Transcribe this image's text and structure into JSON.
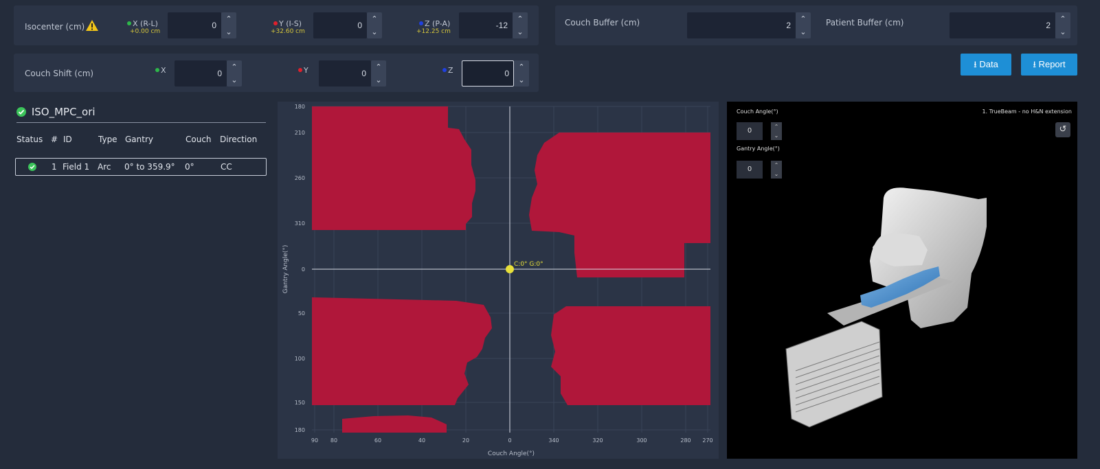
{
  "isocenter": {
    "label": "Isocenter (cm)",
    "warning_icon": "warning-triangle-icon",
    "x": {
      "label": "X (R-L)",
      "sub": "+0.00 cm",
      "value": "0",
      "color": "#2eb84a"
    },
    "y": {
      "label": "Y (I-S)",
      "sub": "+32.60 cm",
      "value": "0",
      "color": "#e0202c"
    },
    "z": {
      "label": "Z (P-A)",
      "sub": "+12.25 cm",
      "value": "-12",
      "color": "#2040e0"
    }
  },
  "couch_buffer": {
    "label": "Couch Buffer (cm)",
    "value": "2"
  },
  "patient_buffer": {
    "label": "Patient Buffer (cm)",
    "value": "2"
  },
  "couch_shift": {
    "label": "Couch Shift (cm)",
    "x": {
      "label": "X",
      "value": "0"
    },
    "y": {
      "label": "Y",
      "value": "0"
    },
    "z": {
      "label": "Z",
      "value": "0"
    }
  },
  "buttons": {
    "data": "Data",
    "report": "Report"
  },
  "plan": {
    "name": "ISO_MPC_ori",
    "columns": [
      "Status",
      "#",
      "ID",
      "Type",
      "Gantry",
      "Couch",
      "Direction"
    ],
    "rows": [
      {
        "num": "1",
        "id": "Field 1",
        "type": "Arc",
        "gantry": "0° to 359.9°",
        "couch": "0°",
        "direction": "CC"
      }
    ]
  },
  "chart_data": {
    "type": "heatmap",
    "xlabel": "Couch Angle(°)",
    "ylabel": "Gantry Angle(°)",
    "x_ticks": [
      "90",
      "80",
      "60",
      "40",
      "20",
      "0",
      "340",
      "320",
      "300",
      "280",
      "270"
    ],
    "y_ticks": [
      "180",
      "210",
      "260",
      "310",
      "0",
      "50",
      "100",
      "150",
      "180"
    ],
    "cursor": {
      "couch": 0,
      "gantry": 0,
      "label": "C:0° G:0°"
    },
    "collision_color": "#b0173a"
  },
  "view3d": {
    "couch_angle_label": "Couch Angle(°)",
    "couch_angle_value": "0",
    "gantry_angle_label": "Gantry Angle(°)",
    "gantry_angle_value": "0",
    "machine": "1. TrueBeam - no H&N extension",
    "reset_icon": "reset-view-icon"
  }
}
